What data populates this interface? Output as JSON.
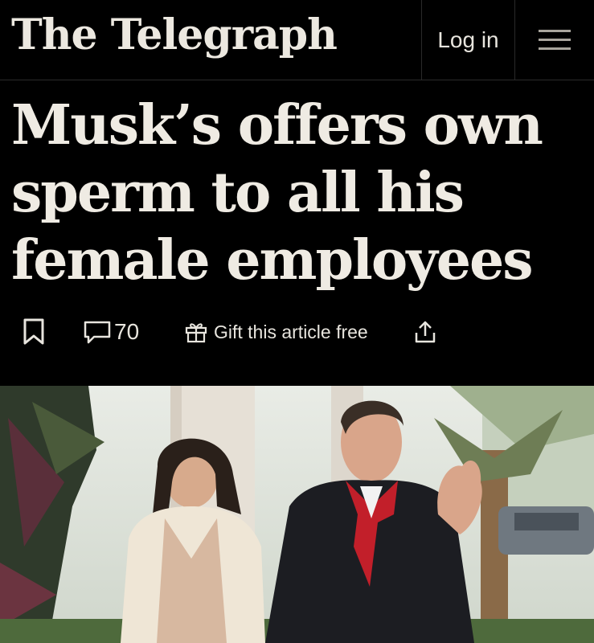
{
  "header": {
    "brand": "The Telegraph",
    "login_label": "Log in",
    "menu_icon": "hamburger-icon"
  },
  "article": {
    "headline": "Musk’s offers own sperm to all his female employees"
  },
  "actions": {
    "bookmark_icon": "bookmark-icon",
    "comment_icon": "comment-icon",
    "comment_count": "70",
    "gift_icon": "gift-icon",
    "gift_label": "Gift this article free",
    "share_icon": "share-icon"
  },
  "photo": {
    "description_icon": "article-photo"
  },
  "colors": {
    "background": "#000000",
    "text": "#efebe3"
  }
}
